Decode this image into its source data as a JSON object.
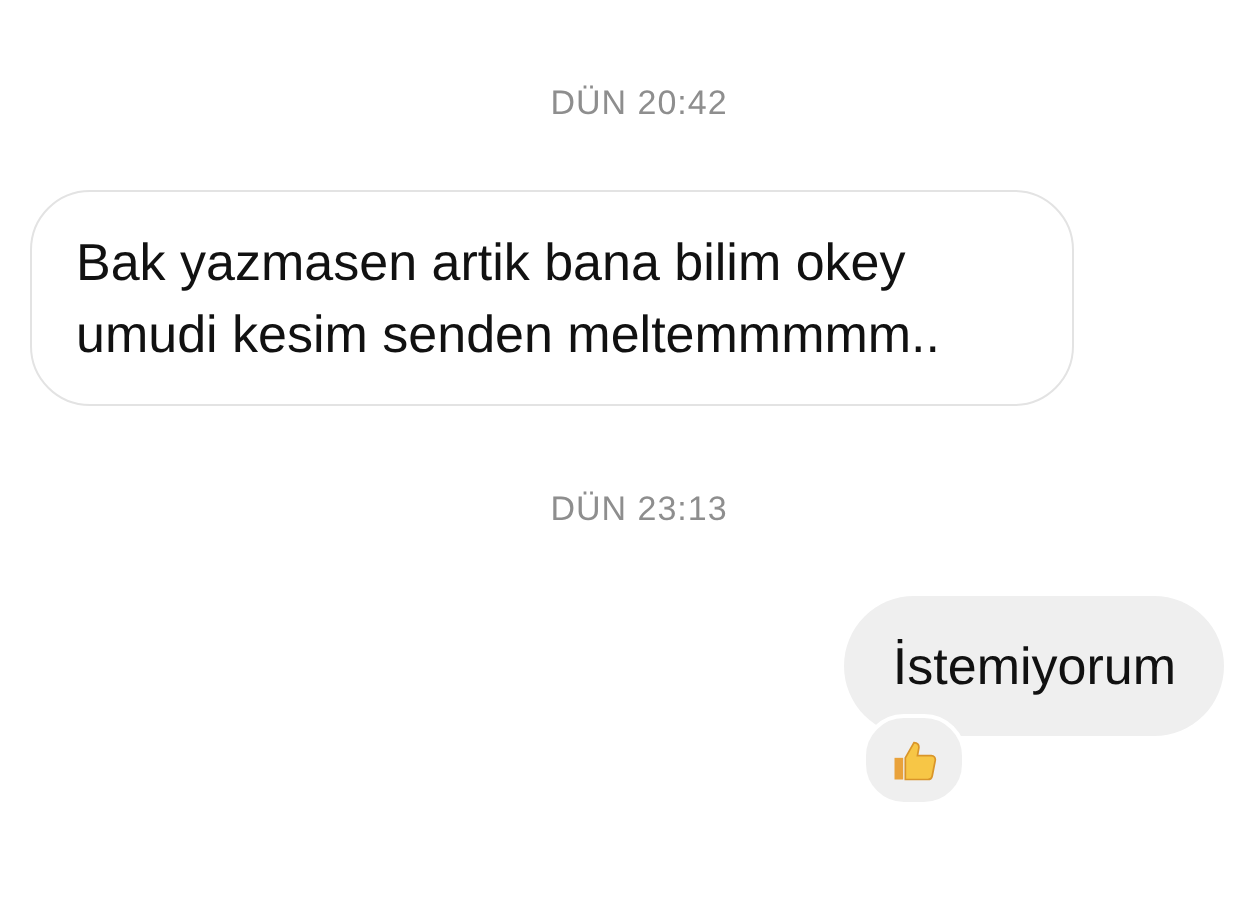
{
  "messages": [
    {
      "kind": "timestamp",
      "text": "DÜN 20:42"
    },
    {
      "kind": "message",
      "outgoing": false,
      "text": "Bak yazmasen artik bana bilim okey umudi kesim senden meltemmmmm..",
      "reacted": false
    },
    {
      "kind": "timestamp",
      "text": "DÜN 23:13"
    },
    {
      "kind": "message",
      "outgoing": true,
      "text": "İstemiyorum",
      "reacted": true
    }
  ]
}
